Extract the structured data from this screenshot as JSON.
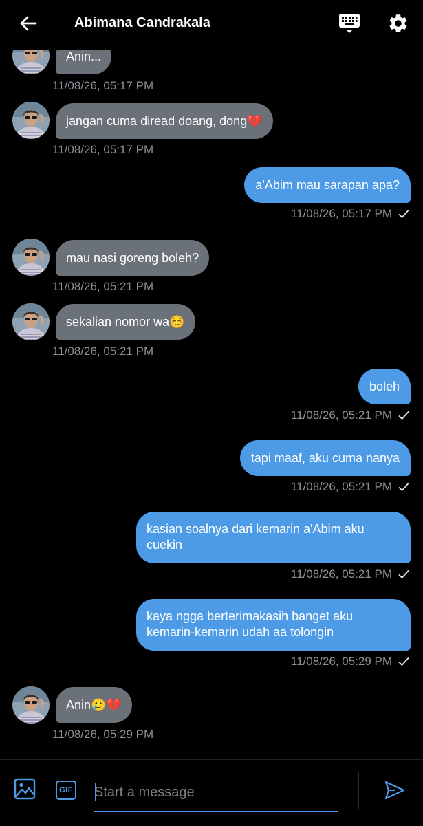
{
  "header": {
    "title": "Abimana Candrakala",
    "back_icon": "arrow-left-icon",
    "keyboard_icon": "keyboard-icon",
    "settings_icon": "gear-icon"
  },
  "messages": [
    {
      "direction": "in",
      "text": "Anin...",
      "time": "11/08/26, 05:17 PM"
    },
    {
      "direction": "in",
      "text": "jangan cuma diread doang, dong💔",
      "time": "11/08/26, 05:17 PM"
    },
    {
      "direction": "out",
      "text": "a'Abim mau sarapan apa?",
      "time": "11/08/26, 05:17 PM"
    },
    {
      "direction": "in",
      "text": "mau nasi goreng boleh?",
      "time": "11/08/26, 05:21 PM"
    },
    {
      "direction": "in",
      "text": "sekalian nomor wa☺️",
      "time": "11/08/26, 05:21 PM"
    },
    {
      "direction": "out",
      "text": "boleh",
      "time": "11/08/26, 05:21 PM"
    },
    {
      "direction": "out",
      "text": "tapi maaf, aku cuma nanya",
      "time": "11/08/26, 05:21 PM"
    },
    {
      "direction": "out",
      "text": "kasian soalnya dari kemarin a'Abim aku cuekin",
      "time": "11/08/26, 05:21 PM"
    },
    {
      "direction": "out",
      "text": "kaya ngga berterimakasih banget aku kemarin-kemarin udah aa tolongin",
      "time": "11/08/26, 05:29 PM"
    },
    {
      "direction": "in",
      "text": "Anin🥲💔",
      "time": "11/08/26, 05:29 PM"
    }
  ],
  "composer": {
    "placeholder": "Start a message",
    "image_icon": "image-icon",
    "gif_label": "GIF",
    "send_icon": "send-icon"
  },
  "colors": {
    "background": "#000000",
    "outgoing_bubble": "#4d9be7",
    "incoming_bubble": "#6b7178",
    "timestamp": "#8b9197",
    "accent": "#4d9be7"
  }
}
